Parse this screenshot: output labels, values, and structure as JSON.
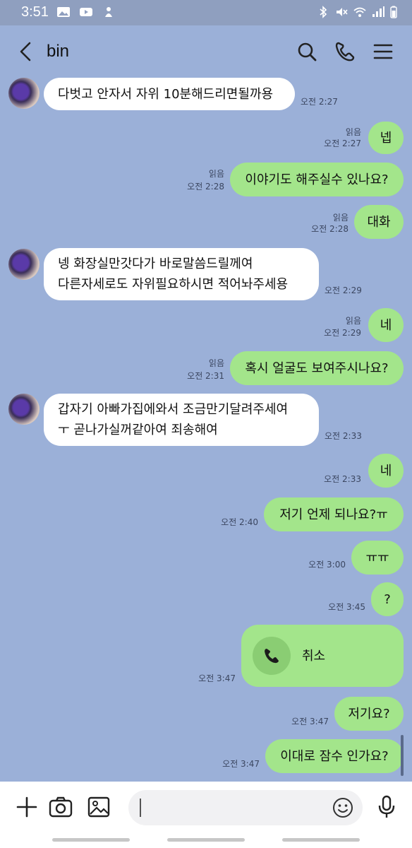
{
  "status": {
    "time": "3:51"
  },
  "header": {
    "title": "bin"
  },
  "messages": [
    {
      "text": "다벗고 안자서 자위 10분해드리면될까용",
      "time": "오전 2:27"
    },
    {
      "text": "넵",
      "read": "읽음",
      "time": "오전 2:27"
    },
    {
      "text": "이야기도 해주실수 있나요?",
      "read": "읽음",
      "time": "오전 2:28"
    },
    {
      "text": "대화",
      "read": "읽음",
      "time": "오전 2:28"
    },
    {
      "line1": "넹 화장실만갓다가 바로말씀드릴께여",
      "line2": "다른자세로도 자위필요하시면 적어놔주세용",
      "time": "오전 2:29"
    },
    {
      "text": "네",
      "read": "읽음",
      "time": "오전 2:29"
    },
    {
      "text": "혹시 얼굴도 보여주시나요?",
      "read": "읽음",
      "time": "오전 2:31"
    },
    {
      "line1": "갑자기 아빠가집에와서 조금만기달려주세여",
      "line2": "ㅜ 곧나가실꺼같아여 죄송해여",
      "time": "오전 2:33"
    },
    {
      "text": "네",
      "time": "오전 2:33"
    },
    {
      "text": "저기 언제 되나요?ㅠ",
      "time": "오전 2:40"
    },
    {
      "text": "ㅠㅠ",
      "time": "오전 3:00"
    },
    {
      "text": "?",
      "time": "오전 3:45"
    },
    {
      "text": "취소",
      "time": "오전 3:47"
    },
    {
      "text": "저기요?",
      "time": "오전 3:47"
    },
    {
      "text": "이대로 잠수 인가요?",
      "time": "오전 3:47"
    }
  ],
  "icons": {
    "back": "chevron-left-icon",
    "search": "search-icon",
    "call": "phone-icon",
    "menu": "hamburger-menu-icon",
    "add": "plus-icon",
    "camera": "camera-icon",
    "gallery": "image-icon",
    "emoji": "emoji-icon",
    "mic": "microphone-icon"
  },
  "colors": {
    "background": "#9bb0d8",
    "outgoing_bubble": "#a3e58b",
    "incoming_bubble": "#ffffff"
  }
}
